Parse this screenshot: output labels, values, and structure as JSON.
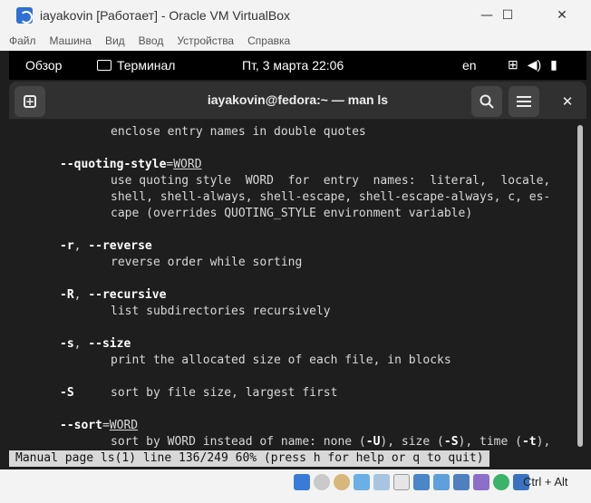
{
  "window": {
    "title": "iayakovin [Работает] - Oracle VM VirtualBox",
    "min_icon": "minimize-icon",
    "max_icon": "maximize-icon",
    "close_icon": "close-icon"
  },
  "menubar": {
    "items": [
      "Файл",
      "Машина",
      "Вид",
      "Ввод",
      "Устройства",
      "Справка"
    ]
  },
  "gnome": {
    "overview": "Обзор",
    "app": "Терминал",
    "clock": "Пт, 3 марта  22:06",
    "lang": "en"
  },
  "terminal": {
    "title": "iayakovin@fedora:~ — man ls",
    "lines": [
      {
        "pre": "         ",
        "text": "enclose entry names in double quotes"
      },
      {
        "pre": "",
        "text": ""
      },
      {
        "pre": "",
        "text": ""
      }
    ],
    "content": {
      "l1": "enclose entry names in double quotes",
      "l3_opt": "--quoting-style",
      "l3_eq": "=",
      "l3_arg": "WORD",
      "l4": "use quoting style  WORD  for  entry  names:  literal,  locale,",
      "l5": "shell, shell-always, shell-escape, shell-escape-always, c, es‐",
      "l6": "cape (overrides QUOTING_STYLE environment variable)",
      "l8_opt1": "-r",
      "l8_sep": ", ",
      "l8_opt2": "--reverse",
      "l9": "reverse order while sorting",
      "l11_opt1": "-R",
      "l11_sep": ", ",
      "l11_opt2": "--recursive",
      "l12": "list subdirectories recursively",
      "l14_opt1": "-s",
      "l14_sep": ", ",
      "l14_opt2": "--size",
      "l15": "print the allocated size of each file, in blocks",
      "l17_opt": "-S",
      "l17_text": "sort by file size, largest first",
      "l19_opt": "--sort",
      "l19_eq": "=",
      "l19_arg": "WORD",
      "l20_a": "sort by WORD instead of name: none (",
      "l20_b": "-U",
      "l20_c": "), size (",
      "l20_d": "-S",
      "l20_e": "), time (",
      "l20_f": "-t",
      "l20_g": "),"
    },
    "status": "Manual page ls(1) line 136/249 60% (press h for help or q to quit)"
  },
  "vbox_status": {
    "host_key": "Ctrl + Alt"
  }
}
